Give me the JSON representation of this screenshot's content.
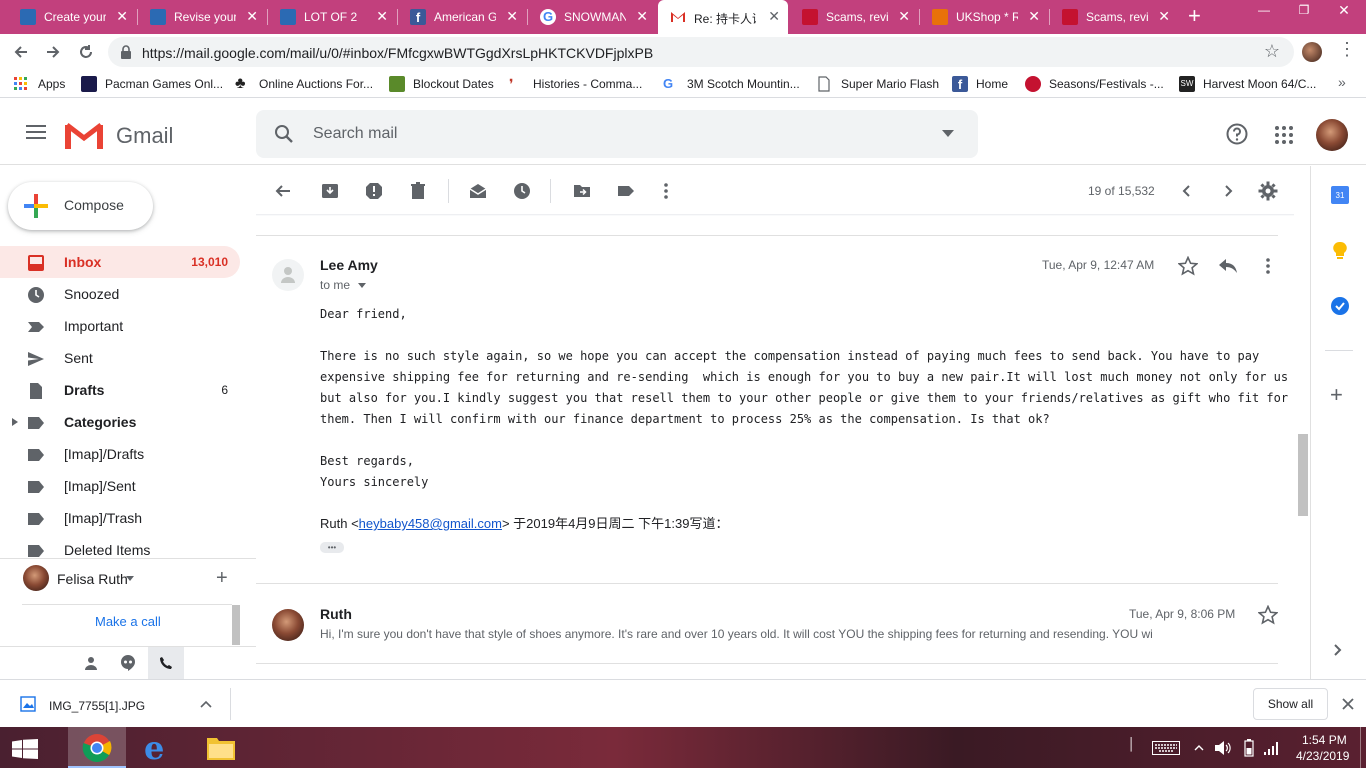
{
  "browser": {
    "tabs": [
      {
        "title": "Create your",
        "fav": "#2b6ab3"
      },
      {
        "title": "Revise your",
        "fav": "#2b6ab3"
      },
      {
        "title": "LOT OF 2",
        "fav": "#2b6ab3"
      },
      {
        "title": "American G",
        "fav": "#3b5998"
      },
      {
        "title": "SNOWMAN",
        "fav": "#4285f4"
      },
      {
        "title": "Re: 持卡人课",
        "fav": "#d93025"
      },
      {
        "title": "Scams, revie",
        "fav": "#c41230"
      },
      {
        "title": "UKShop * R",
        "fav": "#e8710a"
      },
      {
        "title": "Scams, revie",
        "fav": "#c41230"
      }
    ],
    "url": "https://mail.google.com/mail/u/0/#inbox/FMfcgxwBWTGgdXrsLpHKTCKVDFjplxPB",
    "bookmarks": [
      {
        "label": "Apps",
        "color": "#ea4335"
      },
      {
        "label": "Pacman Games Onl...",
        "color": "#1a1a4a"
      },
      {
        "label": "Online Auctions For...",
        "color": "#222222"
      },
      {
        "label": "Blockout Dates",
        "color": "#5a8a2a"
      },
      {
        "label": "Histories - Comma...",
        "color": "#c0392b"
      },
      {
        "label": "3M Scotch Mountin...",
        "color": "#4285f4"
      },
      {
        "label": "Super Mario Flash",
        "color": "#888888"
      },
      {
        "label": "Home",
        "color": "#3b5998"
      },
      {
        "label": "Seasons/Festivals -...",
        "color": "#c41230"
      },
      {
        "label": "Harvest Moon 64/C...",
        "color": "#222222"
      }
    ]
  },
  "gmail": {
    "logo_text": "Gmail",
    "search_placeholder": "Search mail",
    "compose_label": "Compose",
    "nav": [
      {
        "label": "Inbox",
        "count": "13,010",
        "icon": "inbox-icon"
      },
      {
        "label": "Snoozed",
        "count": "",
        "icon": "clock-icon"
      },
      {
        "label": "Important",
        "count": "",
        "icon": "important-icon"
      },
      {
        "label": "Sent",
        "count": "",
        "icon": "send-icon"
      },
      {
        "label": "Drafts",
        "count": "6",
        "icon": "draft-icon"
      },
      {
        "label": "Categories",
        "count": "",
        "icon": "label-icon"
      },
      {
        "label": "[Imap]/Drafts",
        "count": "",
        "icon": "label-icon"
      },
      {
        "label": "[Imap]/Sent",
        "count": "",
        "icon": "label-icon"
      },
      {
        "label": "[Imap]/Trash",
        "count": "",
        "icon": "label-icon"
      },
      {
        "label": "Deleted Items",
        "count": "",
        "icon": "label-icon"
      }
    ],
    "hangouts_user": "Felisa Ruth",
    "make_call": "Make a call",
    "pagination": "19 of 15,532",
    "message1": {
      "sender": "Lee Amy",
      "to": "to me",
      "date": "Tue, Apr 9, 12:47 AM",
      "greeting": "Dear friend,",
      "body_lines": [
        "There is no such style again, so we hope you can accept the compensation instead of paying much fees to send back. You have to pay",
        "expensive shipping fee for returning and re-sending  which is enough for you to buy a new pair.It will lost much money not only for us",
        "but also for you.I kindly suggest you that resell them to your other people or give them to your friends/relatives as gift who fit for",
        "them. Then I will confirm with our finance department to process 25% as the compensation. Is that ok?"
      ],
      "closing1": "Best regards,",
      "closing2": "Yours sincerely",
      "quote_prefix": "Ruth <",
      "quote_email": "heybaby458@gmail.com",
      "quote_suffix": "> 于2019年4月9日周二 下午1:39写道：",
      "ellipsis": "•••"
    },
    "message2": {
      "sender": "Ruth",
      "date": "Tue, Apr 9, 8:06 PM",
      "snippet": "Hi, I'm sure you don't have that style of shoes anymore. It's rare and over 10 years old. It will cost YOU the shipping fees for returning and resending. YOU wi"
    }
  },
  "download": {
    "filename": "IMG_7755[1].JPG",
    "show_all": "Show all"
  },
  "taskbar": {
    "time": "1:54 PM",
    "date": "4/23/2019"
  }
}
